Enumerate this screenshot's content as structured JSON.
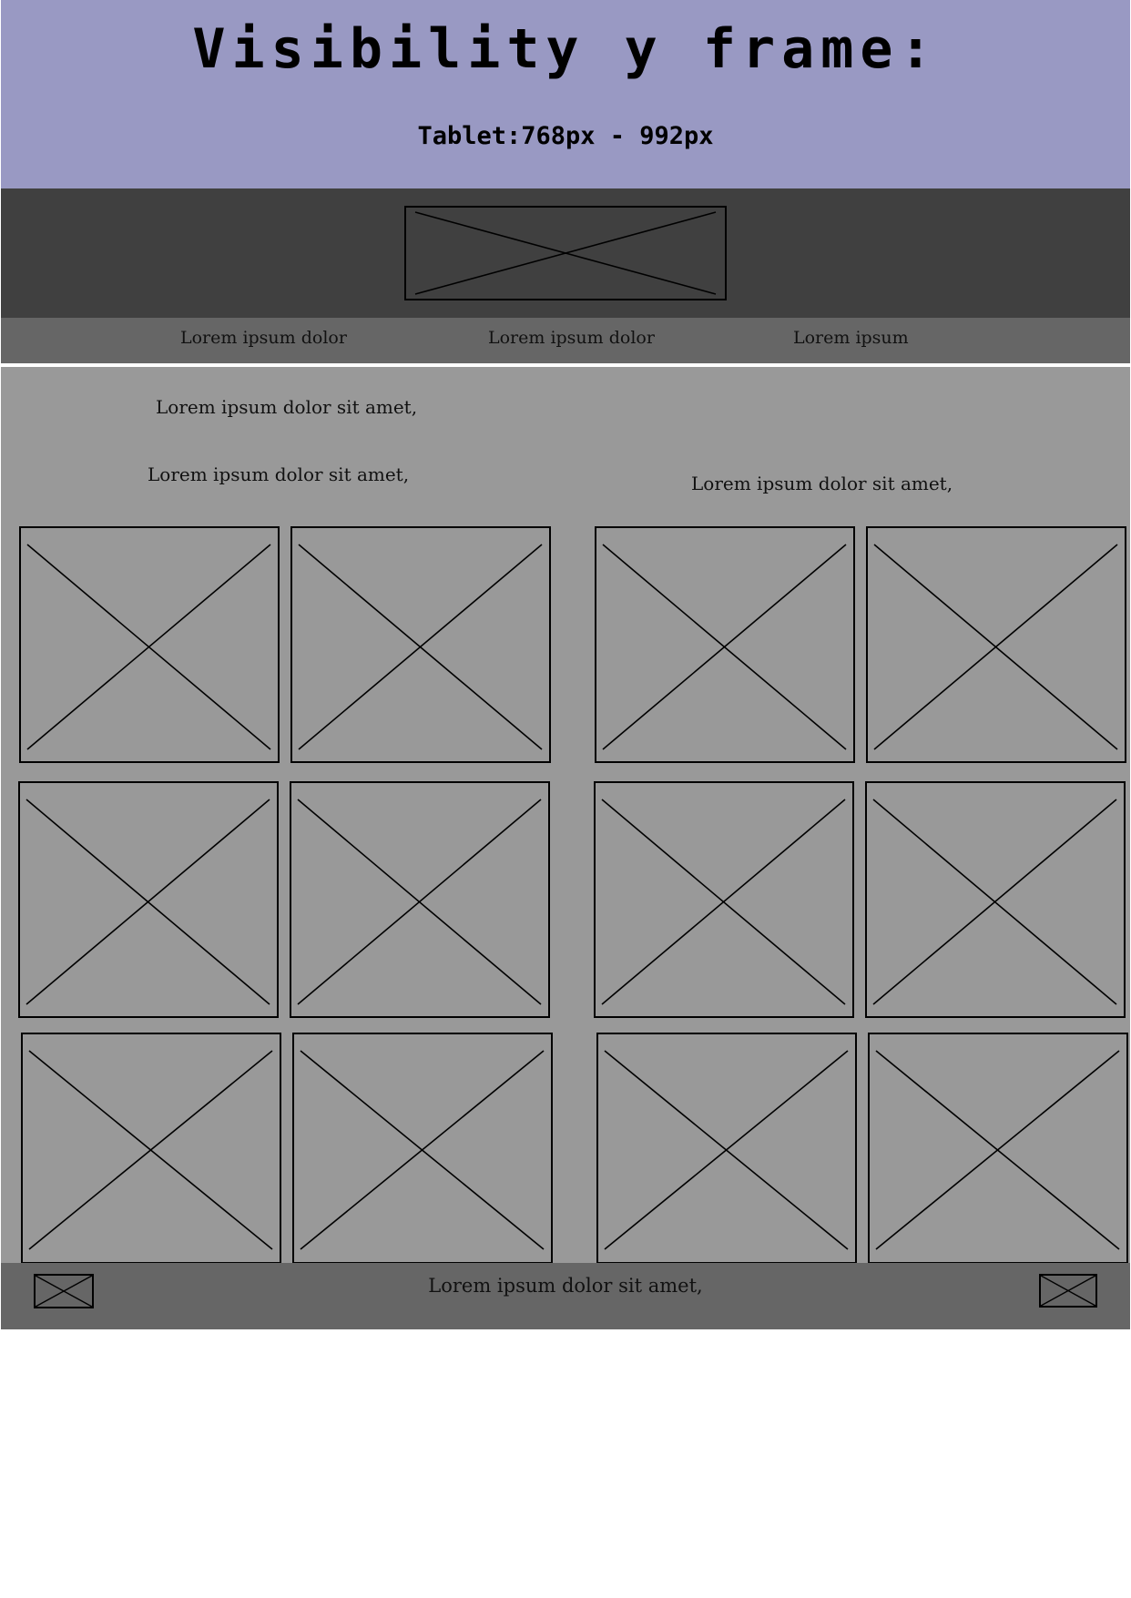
{
  "header": {
    "title": "Visibility y frame:",
    "subtitle": "Tablet:768px - 992px"
  },
  "logo": {
    "icon": "image-placeholder-icon"
  },
  "nav": {
    "items": [
      {
        "label": "Lorem ipsum dolor"
      },
      {
        "label": "Lorem ipsum dolor"
      },
      {
        "label": "Lorem ipsum"
      }
    ]
  },
  "main": {
    "left_column": {
      "heading": "Lorem ipsum dolor sit amet,",
      "subheading": "Lorem ipsum dolor sit amet,"
    },
    "right_column": {
      "heading": "Lorem ipsum dolor sit amet,"
    }
  },
  "footer": {
    "text": "Lorem ipsum dolor sit amet,",
    "left_icon": "image-placeholder-icon",
    "right_icon": "image-placeholder-icon"
  },
  "colors": {
    "title_band": "#9999c3",
    "logo_bar": "#404040",
    "nav_bar": "#666666",
    "content": "#999999",
    "footer": "#666666",
    "stroke": "#000000"
  }
}
